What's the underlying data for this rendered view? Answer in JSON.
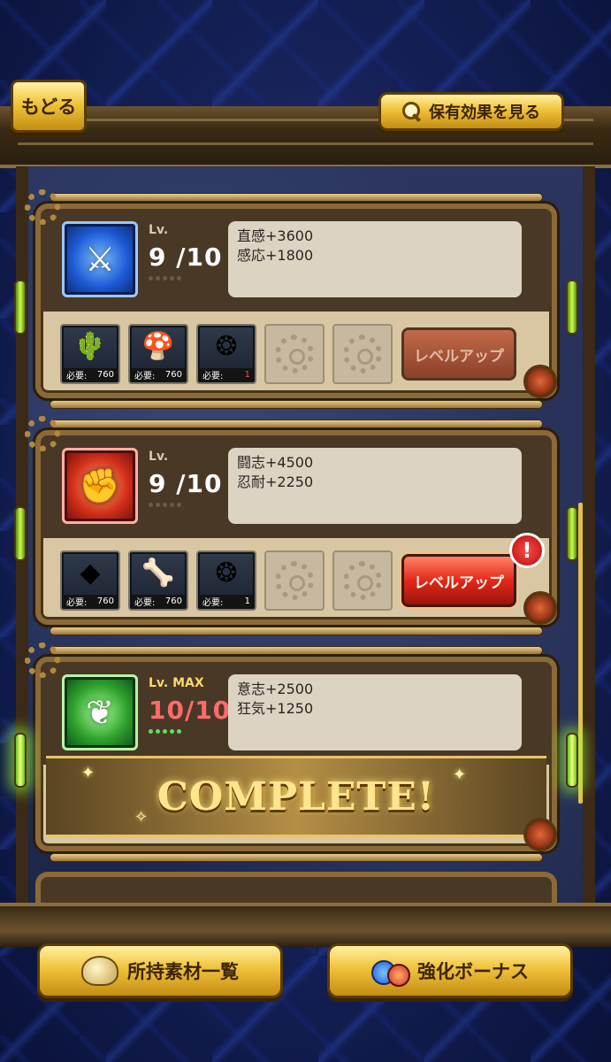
{
  "header": {
    "back_label": "もどる",
    "effect_label": "保有効果を見る"
  },
  "cards": [
    {
      "icon": "blue-crest-icon",
      "lv_label": "Lv.",
      "lv_value": "9 /10",
      "stats": [
        "直感+3600",
        "感応+1800"
      ],
      "materials": [
        {
          "icon": "cactus-icon",
          "need_label": "必要:",
          "count": "760"
        },
        {
          "icon": "mushroom-icon",
          "need_label": "必要:",
          "count": "760"
        },
        {
          "icon": "emerald-gear-icon",
          "need_label": "必要:",
          "count": "1"
        }
      ],
      "level_up_label": "レベルアップ",
      "level_up_state": "disabled"
    },
    {
      "icon": "red-fist-icon",
      "lv_label": "Lv.",
      "lv_value": "9 /10",
      "stats": [
        "闘志+4500",
        "忍耐+2250"
      ],
      "materials": [
        {
          "icon": "green-ore-icon",
          "need_label": "必要:",
          "count": "760"
        },
        {
          "icon": "bone-icon",
          "need_label": "必要:",
          "count": "760"
        },
        {
          "icon": "emerald-gear-icon",
          "need_label": "必要:",
          "count": "1"
        }
      ],
      "level_up_label": "レベルアップ",
      "level_up_state": "active",
      "alert": "!"
    },
    {
      "icon": "green-flame-icon",
      "lv_label": "Lv. MAX",
      "lv_value": "10/10",
      "stats": [
        "意志+2500",
        "狂気+1250"
      ],
      "complete_label": "COMPLETE!"
    }
  ],
  "footer": {
    "materials_label": "所持素材一覧",
    "bonus_label": "強化ボーナス"
  },
  "colors": {
    "gold_button": "#f0c23a",
    "red_button": "#e2281a",
    "max_level": "#ff6b6b",
    "stat_box": "#ddd3c3"
  }
}
